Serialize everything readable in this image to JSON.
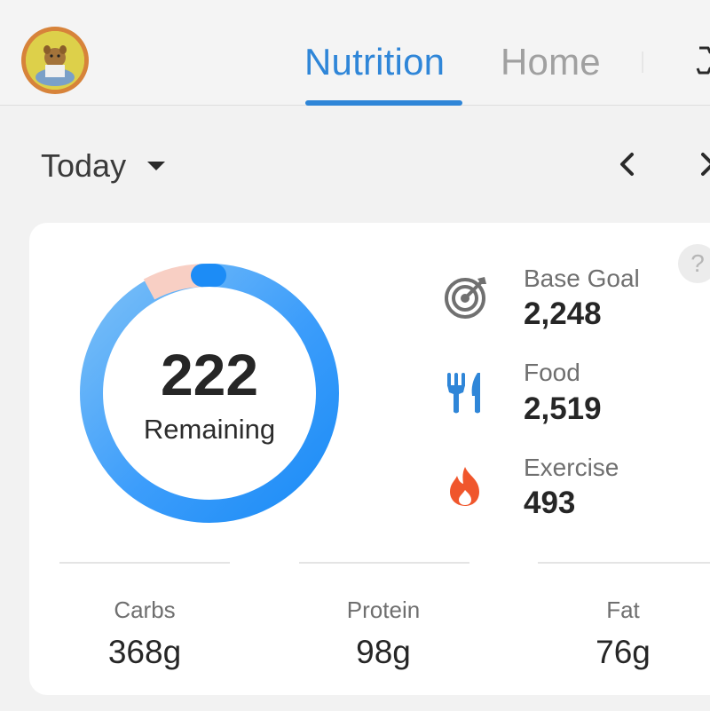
{
  "header": {
    "tabs": [
      {
        "label": "Nutrition",
        "active": true
      },
      {
        "label": "Home",
        "active": false
      }
    ]
  },
  "date_selector": {
    "label": "Today"
  },
  "calories": {
    "remaining_value": "222",
    "remaining_label": "Remaining",
    "ring_colors": {
      "consumed": "#2f86d8",
      "over": "#f8cfc4",
      "light": "#7fc0f4"
    },
    "stats": [
      {
        "label": "Base Goal",
        "value": "2,248",
        "icon": "target-icon"
      },
      {
        "label": "Food",
        "value": "2,519",
        "icon": "fork-knife-icon"
      },
      {
        "label": "Exercise",
        "value": "493",
        "icon": "flame-icon"
      }
    ]
  },
  "help_icon_glyph": "?",
  "macros": [
    {
      "label": "Carbs",
      "value": "368g"
    },
    {
      "label": "Protein",
      "value": "98g"
    },
    {
      "label": "Fat",
      "value": "76g"
    }
  ],
  "colors": {
    "accent": "#2f86d8",
    "flame": "#f0562c",
    "background": "#f2f2f2",
    "card": "#ffffff"
  }
}
